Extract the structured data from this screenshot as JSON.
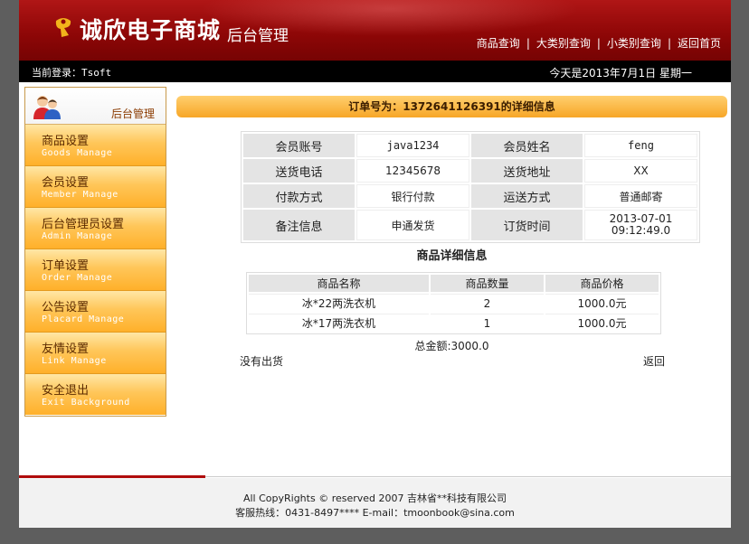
{
  "header": {
    "logo_text": "诚欣电子商城",
    "logo_sub": "后台管理",
    "nav": [
      "商品查询",
      "大类别查询",
      "小类别查询",
      "返回首页"
    ],
    "nav_sep": "|"
  },
  "status": {
    "login": "当前登录：Tsoft",
    "date": "今天是2013年7月1日 星期一"
  },
  "sidebar": {
    "title": "后台管理",
    "items": [
      {
        "cn": "商品设置",
        "en": "Goods Manage"
      },
      {
        "cn": "会员设置",
        "en": "Member Manage"
      },
      {
        "cn": "后台管理员设置",
        "en": "Admin Manage"
      },
      {
        "cn": "订单设置",
        "en": "Order Manage"
      },
      {
        "cn": "公告设置",
        "en": "Placard Manage"
      },
      {
        "cn": "友情设置",
        "en": "Link Manage"
      },
      {
        "cn": "安全退出",
        "en": "Exit Background"
      }
    ]
  },
  "order": {
    "title": "订单号为：1372641126391的详细信息",
    "rows": [
      {
        "l1": "会员账号",
        "v1": "java1234",
        "l2": "会员姓名",
        "v2": "feng"
      },
      {
        "l1": "送货电话",
        "v1": "12345678",
        "l2": "送货地址",
        "v2": "XX"
      },
      {
        "l1": "付款方式",
        "v1": "银行付款",
        "l2": "运送方式",
        "v2": "普通邮寄"
      },
      {
        "l1": "备注信息",
        "v1": "申通发货",
        "l2": "订货时间",
        "v2a": "2013-07-01",
        "v2b": "09:12:49.0"
      }
    ]
  },
  "goods": {
    "title": "商品详细信息",
    "headers": [
      "商品名称",
      "商品数量",
      "商品价格"
    ],
    "rows": [
      [
        "冰*22两洗衣机",
        "2",
        "1000.0元"
      ],
      [
        "冰*17两洗衣机",
        "1",
        "1000.0元"
      ]
    ]
  },
  "total": "总金额:3000.0",
  "ship_status": "没有出货",
  "back_label": "返回",
  "footer": {
    "line1": "All CopyRights © reserved 2007 吉林省**科技有限公司",
    "line2": "客服热线：0431-8497****  E-mail：tmoonbook@sina.com"
  },
  "colors": {
    "header_red": "#8f0707",
    "menu_orange": "#ffb02a",
    "title_bar": "#f7a627"
  }
}
